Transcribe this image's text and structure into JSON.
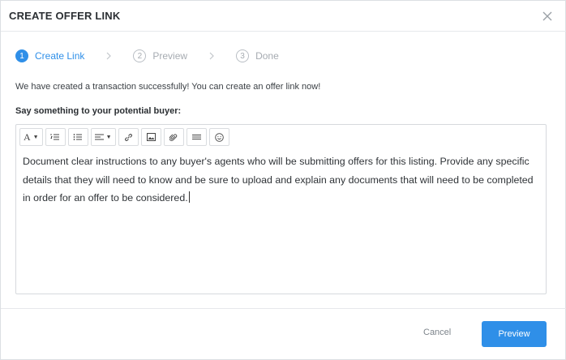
{
  "modal": {
    "title": "CREATE OFFER LINK"
  },
  "steps": [
    {
      "number": "1",
      "label": "Create Link",
      "state": "active"
    },
    {
      "number": "2",
      "label": "Preview",
      "state": "inactive"
    },
    {
      "number": "3",
      "label": "Done",
      "state": "inactive"
    }
  ],
  "messages": {
    "success": "We have created a transaction successfully! You can create an offer link now!",
    "prompt": "Say something to your potential buyer:"
  },
  "editor": {
    "toolbar": [
      {
        "name": "font-style",
        "icon": "font-icon",
        "glyph": "A",
        "dropdown": true
      },
      {
        "name": "ordered-list",
        "icon": "ordered-list-icon"
      },
      {
        "name": "unordered-list",
        "icon": "unordered-list-icon"
      },
      {
        "name": "align",
        "icon": "align-icon",
        "dropdown": true
      },
      {
        "name": "link",
        "icon": "link-icon"
      },
      {
        "name": "image",
        "icon": "image-icon"
      },
      {
        "name": "attachment",
        "icon": "paperclip-icon"
      },
      {
        "name": "horizontal-rule",
        "icon": "horizontal-rule-icon"
      },
      {
        "name": "emoji",
        "icon": "emoji-icon"
      }
    ],
    "content": "Document clear instructions to any buyer's agents who will be submitting offers for this listing. Provide any specific details that they will need to know and be sure to upload and explain any documents that will need to be completed in order for an offer to be considered."
  },
  "footer": {
    "cancel_label": "Cancel",
    "preview_label": "Preview"
  },
  "colors": {
    "accent": "#2f8fe8",
    "inactive": "#a6abb1"
  }
}
